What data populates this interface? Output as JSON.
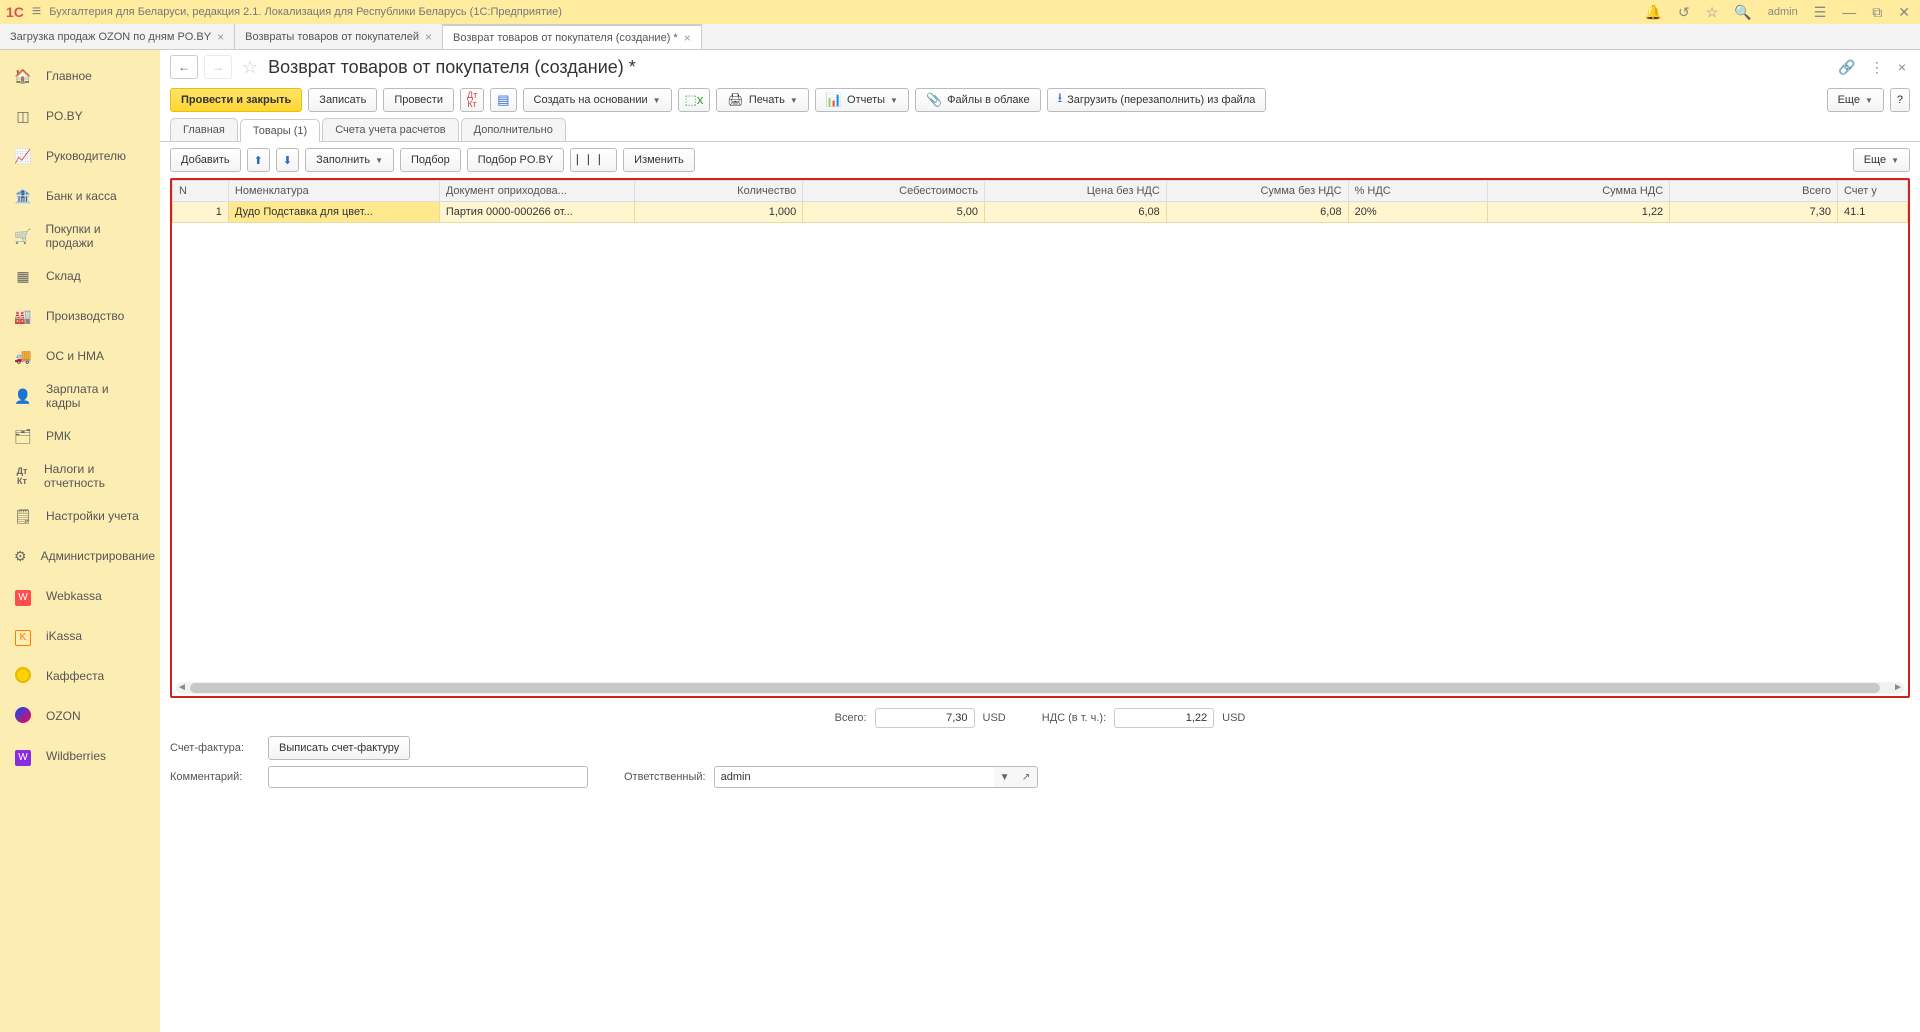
{
  "titlebar": {
    "logo": "1C",
    "app_title": "Бухгалтерия для Беларуси, редакция 2.1. Локализация для Республики Беларусь   (1С:Предприятие)",
    "user": "admin"
  },
  "doc_tabs": [
    {
      "label": "Загрузка продаж OZON по дням PO.BY",
      "active": false
    },
    {
      "label": "Возвраты товаров от покупателей",
      "active": false
    },
    {
      "label": "Возврат товаров от покупателя (создание) *",
      "active": true
    }
  ],
  "sidebar": {
    "items": [
      {
        "icon": "🏠",
        "label": "Главное"
      },
      {
        "icon": "⬚",
        "label": "PO.BY"
      },
      {
        "icon": "📈",
        "label": "Руководителю"
      },
      {
        "icon": "🏦",
        "label": "Банк и касса"
      },
      {
        "icon": "🛒",
        "label": "Покупки и продажи"
      },
      {
        "icon": "▦",
        "label": "Склад"
      },
      {
        "icon": "🏭",
        "label": "Производство"
      },
      {
        "icon": "🚚",
        "label": "ОС и НМА"
      },
      {
        "icon": "👤",
        "label": "Зарплата и кадры"
      },
      {
        "icon": "🗂",
        "label": "РМК"
      },
      {
        "icon": "Дт",
        "label": "Налоги и отчетность"
      },
      {
        "icon": "🗒",
        "label": "Настройки учета"
      },
      {
        "icon": "⚙",
        "label": "Администрирование"
      },
      {
        "icon": "W",
        "label": "Webkassa",
        "box": "#ff4d4d"
      },
      {
        "icon": "K",
        "label": "iKassa",
        "box": "#ff7a00"
      },
      {
        "icon": "●",
        "label": "Каффеста",
        "circle": "yellow"
      },
      {
        "icon": "O",
        "label": "OZON",
        "gradient": true
      },
      {
        "icon": "W",
        "label": "Wildberries",
        "box": "#8a2be2"
      }
    ]
  },
  "doc_header": {
    "title": "Возврат товаров от покупателя (создание) *"
  },
  "toolbar": {
    "post_close": "Провести и закрыть",
    "save": "Записать",
    "post": "Провести",
    "create_based": "Создать на основании",
    "print": "Печать",
    "reports": "Отчеты",
    "files": "Файлы в облаке",
    "reload": "Загрузить (перезаполнить) из файла",
    "more": "Еще"
  },
  "inner_tabs": [
    {
      "label": "Главная",
      "active": false
    },
    {
      "label": "Товары (1)",
      "active": true
    },
    {
      "label": "Счета учета расчетов",
      "active": false
    },
    {
      "label": "Дополнительно",
      "active": false
    }
  ],
  "table_toolbar": {
    "add": "Добавить",
    "fill": "Заполнить",
    "pick": "Подбор",
    "pick_poby": "Подбор PO.BY",
    "edit": "Изменить",
    "more": "Еще"
  },
  "table": {
    "headers": {
      "n": "N",
      "nomen": "Номенклатура",
      "doc": "Документ оприходова...",
      "qty": "Количество",
      "cost": "Себестоимость",
      "price": "Цена без НДС",
      "sum": "Сумма без НДС",
      "vatp": "% НДС",
      "vats": "Сумма НДС",
      "total": "Всего",
      "acct": "Счет у"
    },
    "rows": [
      {
        "n": "1",
        "nomen": "Дудо Подставка для цвет...",
        "doc": "Партия 0000-000266 от...",
        "qty": "1,000",
        "cost": "5,00",
        "price": "6,08",
        "sum": "6,08",
        "vatp": "20%",
        "vats": "1,22",
        "total": "7,30",
        "acct": "41.1"
      }
    ]
  },
  "totals": {
    "total_label": "Всего:",
    "total_value": "7,30",
    "vat_label": "НДС (в т. ч.):",
    "vat_value": "1,22",
    "currency": "USD"
  },
  "footer": {
    "invoice_label": "Счет-фактура:",
    "invoice_btn": "Выписать счет-фактуру",
    "comment_label": "Комментарий:",
    "comment_value": "",
    "responsible_label": "Ответственный:",
    "responsible_value": "admin"
  }
}
